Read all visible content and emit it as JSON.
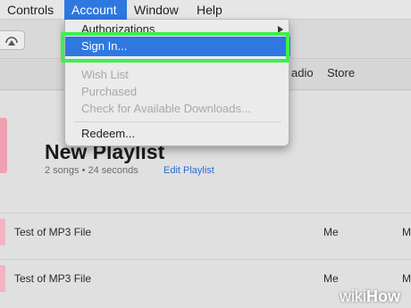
{
  "menubar": {
    "items": [
      {
        "label": "Controls"
      },
      {
        "label": "Account"
      },
      {
        "label": "Window"
      },
      {
        "label": "Help"
      }
    ]
  },
  "nav": {
    "items": [
      {
        "label": "adio"
      },
      {
        "label": "Store"
      }
    ]
  },
  "account_menu": {
    "items": [
      {
        "label": "Authorizations",
        "state": "enabled",
        "has_submenu": true
      },
      {
        "label": "Sign In...",
        "state": "selected"
      },
      {
        "label": "Wish List",
        "state": "disabled"
      },
      {
        "label": "Purchased",
        "state": "disabled"
      },
      {
        "label": "Check for Available Downloads...",
        "state": "disabled"
      },
      {
        "label": "Redeem...",
        "state": "enabled"
      }
    ]
  },
  "playlist": {
    "title": "New Playlist",
    "meta": "2 songs • 24 seconds",
    "edit_label": "Edit Playlist"
  },
  "songs": [
    {
      "title": "Test of MP3 File",
      "artist": "Me",
      "album": "M"
    },
    {
      "title": "Test of MP3 File",
      "artist": "Me",
      "album": "M"
    }
  ],
  "watermark": {
    "part1": "wiki",
    "part2": "How"
  },
  "colors": {
    "menu_highlight": "#2f78e0",
    "callout_box": "#3df04a",
    "link": "#2a6fd6"
  }
}
